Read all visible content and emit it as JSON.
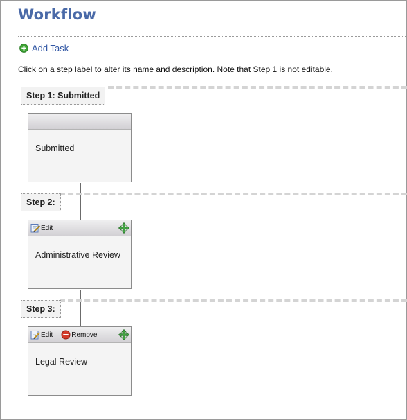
{
  "page": {
    "title": "Workflow",
    "add_task_label": "Add Task",
    "instructions": "Click on a step label to alter its name and description. Note that Step 1 is not editable."
  },
  "steps": [
    {
      "label": "Step 1: Submitted",
      "task": {
        "name": "Submitted",
        "edit_label": "",
        "remove_label": ""
      }
    },
    {
      "label": "Step 2:",
      "task": {
        "name": "Administrative Review",
        "edit_label": "Edit",
        "remove_label": ""
      }
    },
    {
      "label": "Step 3:",
      "task": {
        "name": "Legal Review",
        "edit_label": "Edit",
        "remove_label": "Remove"
      }
    }
  ],
  "icons": {
    "add": "plus-circle-icon",
    "edit": "pencil-edit-icon",
    "remove": "minus-circle-icon",
    "move": "move-arrows-icon"
  },
  "colors": {
    "title": "#4a6aa8",
    "link": "#2f55a3",
    "add_icon": "#3fa535",
    "remove_icon": "#d33a2a",
    "move_icon": "#3a9b3a"
  }
}
